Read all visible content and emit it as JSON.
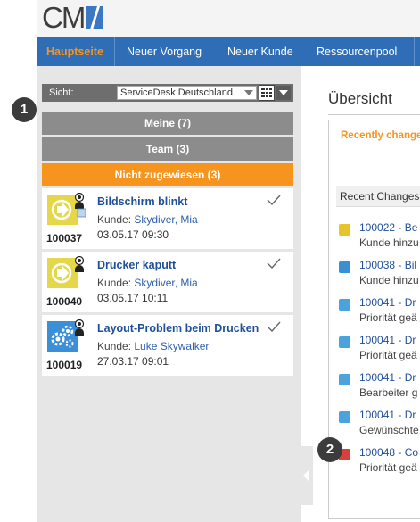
{
  "logo": {
    "text": "CM"
  },
  "nav": {
    "items": [
      {
        "label": "Hauptseite",
        "active": true
      },
      {
        "label": "Neuer Vorgang",
        "active": false
      },
      {
        "label": "Neuer Kunde",
        "active": false
      },
      {
        "label": "Ressourcenpool",
        "active": false
      }
    ]
  },
  "colors": {
    "nav_bg": "#2f6eb6",
    "accent": "#f7941d",
    "group_bar": "#8c8c8c",
    "link": "#1f4f9a"
  },
  "left": {
    "sicht_label": "Sicht:",
    "sicht_value": "ServiceDesk Deutschland",
    "groups": {
      "meine": "Meine (7)",
      "team": "Team (3)",
      "nicht": "Nicht zugewiesen (3)"
    },
    "tickets": [
      {
        "id": "100037",
        "title": "Bildschirm blinkt",
        "kunde_label": "Kunde: ",
        "kunde": "Skydiver, Mia",
        "date": "03.05.17 09:30",
        "icon": "arrow-circle-icon"
      },
      {
        "id": "100040",
        "title": "Drucker kaputt",
        "kunde_label": "Kunde: ",
        "kunde": "Skydiver, Mia",
        "date": "03.05.17 10:11",
        "icon": "arrow-circle-icon"
      },
      {
        "id": "100019",
        "title": "Layout-Problem beim Drucken",
        "kunde_label": "Kunde: ",
        "kunde": "Luke Skywalker",
        "date": "27.03.17 09:01",
        "icon": "gears-icon"
      }
    ]
  },
  "right": {
    "title": "Übersicht",
    "recent_orange": "Recently change",
    "recent_head": "Recent Changes",
    "entries": [
      {
        "link": "100022 - Be",
        "desc": "Kunde hinzu",
        "icon_color": "#e8c42a"
      },
      {
        "link": "100038 - Bil",
        "desc": "Kunde hinzu",
        "icon_color": "#3b8fd6"
      },
      {
        "link": "100041 - Dr",
        "desc": "Priorität geä",
        "icon_color": "#4aa3dd"
      },
      {
        "link": "100041 - Dr",
        "desc": "Priorität geä",
        "icon_color": "#4aa3dd"
      },
      {
        "link": "100041 - Dr",
        "desc": "Bearbeiter g",
        "icon_color": "#4aa3dd"
      },
      {
        "link": "100041 - Dr",
        "desc": "Gewünschte",
        "icon_color": "#4aa3dd"
      },
      {
        "link": "100048 - Co",
        "desc": "Priorität geä",
        "icon_color": "#d9403a"
      }
    ]
  },
  "badges": {
    "one": "1",
    "two": "2"
  }
}
